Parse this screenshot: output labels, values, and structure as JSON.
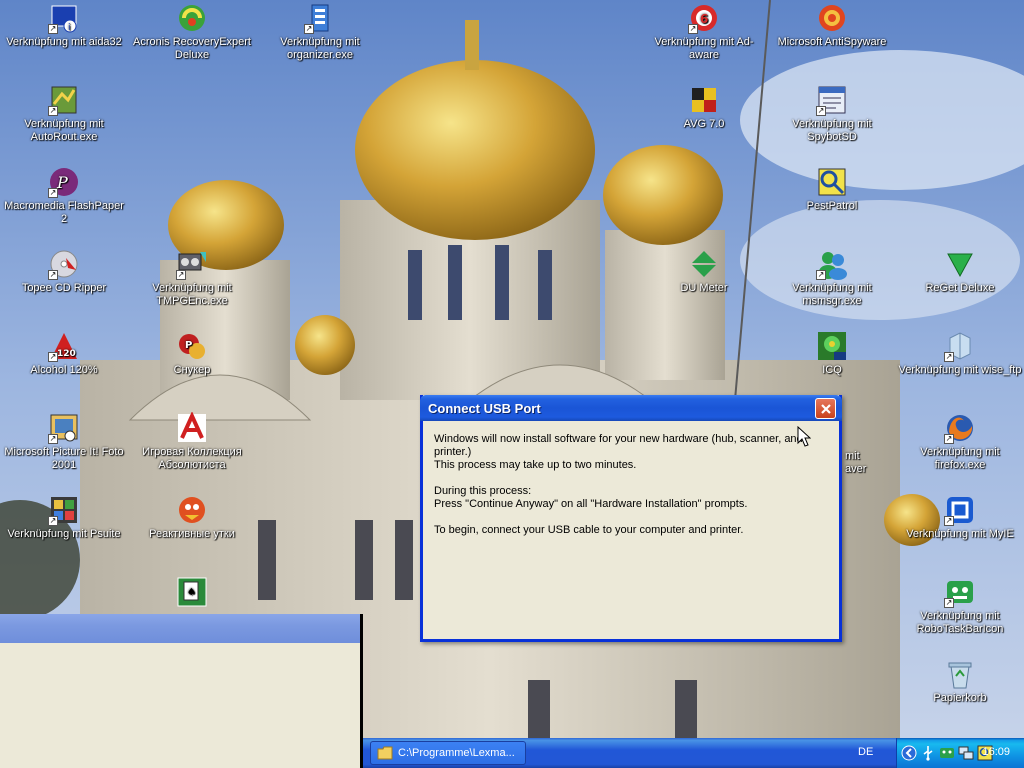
{
  "desktop": {
    "icons": [
      {
        "label": "Verknüpfung mit aida32",
        "icon": "aida32-icon",
        "color": "#2a4fcf"
      },
      {
        "label": "Acronis RecoveryExpert Deluxe",
        "icon": "acronis-icon",
        "color": "#3aa23a"
      },
      {
        "label": "Verknüpfung mit organizer.exe",
        "icon": "organizer-icon",
        "color": "#3f7fd8"
      },
      {
        "label": "Verknüpfung mit Ad-aware",
        "icon": "adaware-icon",
        "color": "#d82a2a"
      },
      {
        "label": "Microsoft AntiSpyware",
        "icon": "antispyware-icon",
        "color": "#e0451e"
      },
      {
        "label": "Verknüpfung mit AutoRout.exe",
        "icon": "autorout-icon",
        "color": "#5a8a3a"
      },
      {
        "label": "AVG 7.0",
        "icon": "avg-icon",
        "color": "#c0201a"
      },
      {
        "label": "Verknüpfung mit SpybotSD",
        "icon": "spybot-icon",
        "color": "#7aa0d8"
      },
      {
        "label": "Macromedia FlashPaper 2",
        "icon": "flashpaper-icon",
        "color": "#8a2a8a"
      },
      {
        "label": "PestPatrol",
        "icon": "pestpatrol-icon",
        "color": "#e8d23a"
      },
      {
        "label": "Topee CD Ripper",
        "icon": "cdripper-icon",
        "color": "#d0d0d8"
      },
      {
        "label": "Verknüpfung mit TMPGEnc.exe",
        "icon": "tmpgenc-icon",
        "color": "#606060"
      },
      {
        "label": "DU Meter",
        "icon": "dumeter-icon",
        "color": "#2aa04a"
      },
      {
        "label": "Verknüpfung mit msmsgr.exe",
        "icon": "msn-icon",
        "color": "#3a8ad8"
      },
      {
        "label": "ReGet Deluxe",
        "icon": "reget-icon",
        "color": "#2ab04a"
      },
      {
        "label": "Alcohol 120%",
        "icon": "alcohol-icon",
        "color": "#d02020"
      },
      {
        "label": "Снукер",
        "icon": "snooker-icon",
        "color": "#c02020"
      },
      {
        "label": "ICQ",
        "icon": "icq-icon",
        "color": "#2a9a2a"
      },
      {
        "label": "Verknüpfung mit wise_ftp",
        "icon": "wiseftp-icon",
        "color": "#a8c8e8"
      },
      {
        "label": "Microsoft Picture It! Foto 2001",
        "icon": "pictureit-icon",
        "color": "#d8a040"
      },
      {
        "label": "Игровая Коллекция Абсолютиста",
        "icon": "games-collection-icon",
        "color": "#d02020"
      },
      {
        "label": "Verknüpfung mit firefox.exe",
        "icon": "firefox-icon",
        "color": "#e87a1e"
      },
      {
        "label": "Verknüpfung mit Psuite",
        "icon": "psuite-icon",
        "color": "#4a4a4a"
      },
      {
        "label": "Реактивные утки",
        "icon": "ducks-icon",
        "color": "#d04020"
      },
      {
        "label": "Verknüpfung mit MyIE",
        "icon": "myie-icon",
        "color": "#1a5ad0"
      },
      {
        "label": "",
        "icon": "solitaire-icon",
        "color": "#2a8a3a"
      },
      {
        "label": "Verknüpfung mit RoboTaskBarIcon",
        "icon": "robotaskbar-icon",
        "color": "#2aa04a"
      },
      {
        "label": "Papierkorb",
        "icon": "recycle-bin-icon",
        "color": "#9ab8d0"
      },
      {
        "label": "mit",
        "icon": "partial-icon",
        "color": "#2a9a2a"
      },
      {
        "label": "aver",
        "icon": "partial2-icon",
        "color": "#2a9a2a"
      }
    ]
  },
  "dialog": {
    "title": "Connect USB Port",
    "line1": "Windows will now install software for your new hardware (hub, scanner, and printer.)",
    "line2": "This process may take up to two minutes.",
    "line3": "During this process:",
    "line4": "Press \"Continue Anyway\" on all \"Hardware Installation\" prompts.",
    "line5": "To begin, connect your USB cable to your computer and printer."
  },
  "taskbar": {
    "task_label": "C:\\Programme\\Lexma...",
    "language": "DE",
    "clock": "16:09"
  }
}
